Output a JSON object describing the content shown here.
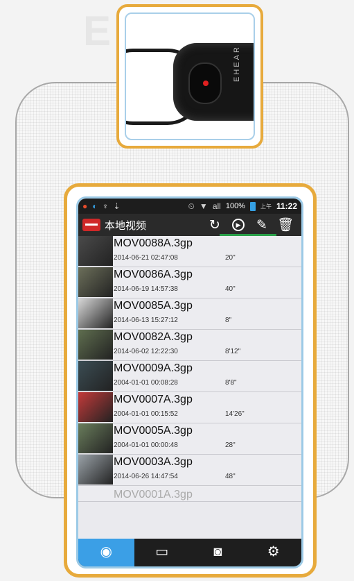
{
  "device_photo": {
    "brand": "EHEAR"
  },
  "status_bar": {
    "signal_label": "all",
    "battery_percent": "100%",
    "ampm": "上午",
    "time": "11:22"
  },
  "action_bar": {
    "title": "本地视频",
    "icons": [
      "refresh-icon",
      "play-icon",
      "edit-icon",
      "delete-icon"
    ]
  },
  "videos": [
    {
      "name": "MOV0088A.3gp",
      "date": "2014-06-21 02:47:08",
      "duration": "20\"",
      "thumb": "#4a4a4a"
    },
    {
      "name": "MOV0086A.3gp",
      "date": "2014-06-19 14:57:38",
      "duration": "40\"",
      "thumb": "#6c6f5a"
    },
    {
      "name": "MOV0085A.3gp",
      "date": "2014-06-13 15:27:12",
      "duration": "8\"",
      "thumb": "#d8d8d8"
    },
    {
      "name": "MOV0082A.3gp",
      "date": "2014-06-02 12:22:30",
      "duration": "8'12\"",
      "thumb": "#5f6e4f"
    },
    {
      "name": "MOV0009A.3gp",
      "date": "2004-01-01 00:08:28",
      "duration": "8'8\"",
      "thumb": "#3b4d54"
    },
    {
      "name": "MOV0007A.3gp",
      "date": "2004-01-01 00:15:52",
      "duration": "14'26\"",
      "thumb": "#c33a3a"
    },
    {
      "name": "MOV0005A.3gp",
      "date": "2004-01-01 00:00:48",
      "duration": "28\"",
      "thumb": "#6a7d5c"
    },
    {
      "name": "MOV0003A.3gp",
      "date": "2014-06-26 14:47:54",
      "duration": "48\"",
      "thumb": "#9aa2a8"
    }
  ],
  "partial_row": {
    "name": "MOV0001A.3gp"
  },
  "tabs": [
    {
      "label": "",
      "icon": "video-icon",
      "active": true
    },
    {
      "label": "",
      "icon": "recorder-icon",
      "active": false
    },
    {
      "label": "",
      "icon": "camera-icon",
      "active": false
    },
    {
      "label": "",
      "icon": "settings-icon",
      "active": false
    }
  ],
  "colors": {
    "frame_accent": "#e7aa3c",
    "screen_border": "#9ccae6",
    "active_tab": "#3b9fe6",
    "app_logo": "#d02828"
  }
}
